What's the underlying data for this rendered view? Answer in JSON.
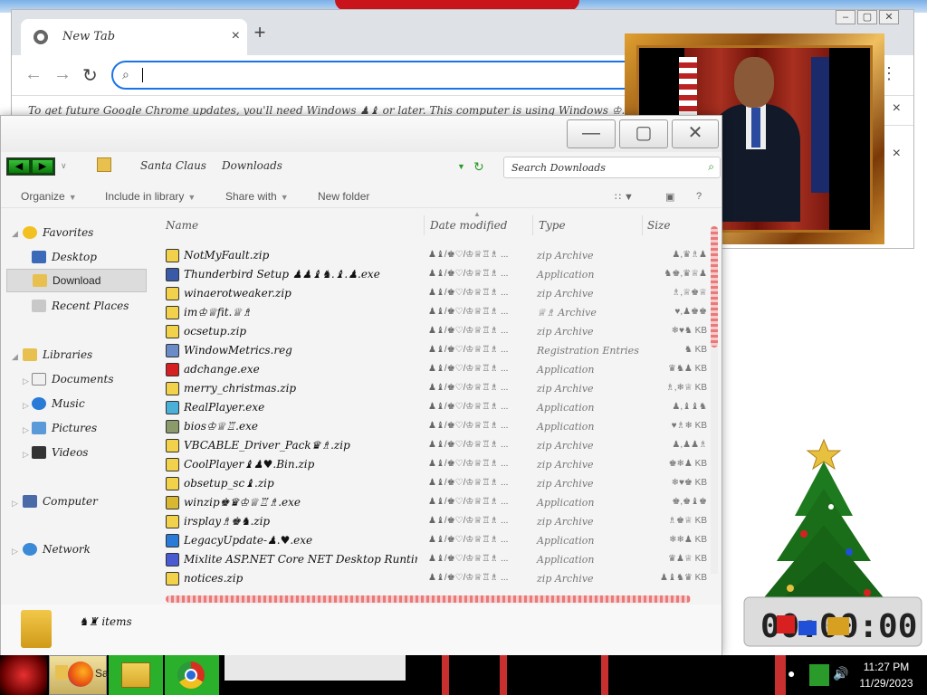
{
  "chrome": {
    "tab_title": "New Tab",
    "tab_close": "×",
    "new_tab": "+",
    "back": "←",
    "forward": "→",
    "reload": "↻",
    "menu": "⋮",
    "omnibox_value": "",
    "info_message": "To get future Google Chrome updates, you'll need Windows ♟♝ or later. This computer is using Windows ♔.",
    "dismiss": "×",
    "win_min": "–",
    "win_max": "▢",
    "win_close": "✕"
  },
  "explorer": {
    "min": "—",
    "max": "▢",
    "close": "✕",
    "nav_back": "◀",
    "nav_fwd": "▶",
    "crumbs": [
      "Santa Claus",
      "Downloads"
    ],
    "search_placeholder": "Search Downloads",
    "toolbar": {
      "organize": "Organize",
      "include": "Include in library",
      "share": "Share with",
      "new_folder": "New folder",
      "help": "?"
    },
    "nav": {
      "favorites": "Favorites",
      "desktop": "Desktop",
      "download": "Download",
      "recent": "Recent Places",
      "libraries": "Libraries",
      "documents": "Documents",
      "music": "Music",
      "pictures": "Pictures",
      "videos": "Videos",
      "computer": "Computer",
      "network": "Network"
    },
    "columns": {
      "name": "Name",
      "date": "Date modified",
      "type": "Type",
      "size": "Size"
    },
    "files": [
      {
        "name": "NotMyFault.zip",
        "date": "♟♝/♚♡/♔♕♖♗ ...",
        "type": "zip Archive",
        "size": "♟,♛♗♟",
        "icon": "zip",
        "color": "#f2d24a"
      },
      {
        "name": "Thunderbird Setup ♟♟♝♞.♝.♟.exe",
        "date": "♟♝/♚♡/♔♕♖♗ ...",
        "type": "Application",
        "size": "♞♚,♛♕♟",
        "icon": "app",
        "color": "#3a5aa8"
      },
      {
        "name": "winaerotweaker.zip",
        "date": "♟♝/♚♡/♔♕♖♗ ...",
        "type": "zip Archive",
        "size": "♗,♕♚♕",
        "icon": "zip",
        "color": "#f2d24a"
      },
      {
        "name": "im♔♕fit.♕♗",
        "date": "♟♝/♚♡/♔♕♖♗ ...",
        "type": "♕♗ Archive",
        "size": "♥,♟♚♚",
        "icon": "zip",
        "color": "#f2d24a"
      },
      {
        "name": "ocsetup.zip",
        "date": "♟♝/♚♡/♔♕♖♗ ...",
        "type": "zip Archive",
        "size": "❄♥♞ KB",
        "icon": "zip",
        "color": "#f2d24a"
      },
      {
        "name": "WindowMetrics.reg",
        "date": "♟♝/♚♡/♔♕♖♗ ...",
        "type": "Registration Entries",
        "size": "♞ KB",
        "icon": "reg",
        "color": "#6a8ac8"
      },
      {
        "name": "adchange.exe",
        "date": "♟♝/♚♡/♔♕♖♗ ...",
        "type": "Application",
        "size": "♛♞♟ KB",
        "icon": "red",
        "color": "#d42020"
      },
      {
        "name": "merry_christmas.zip",
        "date": "♟♝/♚♡/♔♕♖♗ ...",
        "type": "zip Archive",
        "size": "♗,❄♕ KB",
        "icon": "zip",
        "color": "#f2d24a"
      },
      {
        "name": "RealPlayer.exe",
        "date": "♟♝/♚♡/♔♕♖♗ ...",
        "type": "Application",
        "size": "♟,♝♝♞",
        "icon": "rp",
        "color": "#4ab0d8"
      },
      {
        "name": "bios♔♕♖.exe",
        "date": "♟♝/♚♡/♔♕♖♗ ...",
        "type": "Application",
        "size": "♥♗❄ KB",
        "icon": "chip",
        "color": "#8a9a6a"
      },
      {
        "name": "VBCABLE_Driver_Pack♛♗.zip",
        "date": "♟♝/♚♡/♔♕♖♗ ...",
        "type": "zip Archive",
        "size": "♟,♟♟♗",
        "icon": "zip",
        "color": "#f2d24a"
      },
      {
        "name": "CoolPlayer♝♟♥.Bin.zip",
        "date": "♟♝/♚♡/♔♕♖♗ ...",
        "type": "zip Archive",
        "size": "♚❄♟ KB",
        "icon": "zip",
        "color": "#f2d24a"
      },
      {
        "name": "obsetup_sc♝.zip",
        "date": "♟♝/♚♡/♔♕♖♗ ...",
        "type": "zip Archive",
        "size": "❄♥♚ KB",
        "icon": "zip",
        "color": "#f2d24a"
      },
      {
        "name": "winzip♚♛♔♕♖♗.exe",
        "date": "♟♝/♚♡/♔♕♖♗ ...",
        "type": "Application",
        "size": "♚,♚♝♚",
        "icon": "wz",
        "color": "#d8b830"
      },
      {
        "name": "irsplay♗♚♞.zip",
        "date": "♟♝/♚♡/♔♕♖♗ ...",
        "type": "zip Archive",
        "size": "♗♚♕ KB",
        "icon": "zip",
        "color": "#f2d24a"
      },
      {
        "name": "LegacyUpdate-♟.♥.exe",
        "date": "♟♝/♚♡/♔♕♖♗ ...",
        "type": "Application",
        "size": "❄❄♟ KB",
        "icon": "globe",
        "color": "#2a7ad8"
      },
      {
        "name": "Mixlite ASP.NET Core NET Desktop Runtime ♞...",
        "date": "♟♝/♚♡/♔♕♖♗ ...",
        "type": "Application",
        "size": "♛♟♕ KB",
        "icon": "blue",
        "color": "#4a5ad0"
      },
      {
        "name": "notices.zip",
        "date": "♟♝/♚♡/♔♕♖♗ ...",
        "type": "zip Archive",
        "size": "♟♝♞♛ KB",
        "icon": "zip",
        "color": "#f2d24a"
      }
    ],
    "status_text": "♞♜ items"
  },
  "taskbar": {
    "time": "11:27 PM",
    "date": "11/29/2023",
    "sa_label": "Sa"
  },
  "clock_widget": {
    "display": "00:00:00"
  },
  "colors": {
    "accent": "#1a73e8",
    "taskbar": "#000000",
    "scroll": "#e87a7a"
  }
}
